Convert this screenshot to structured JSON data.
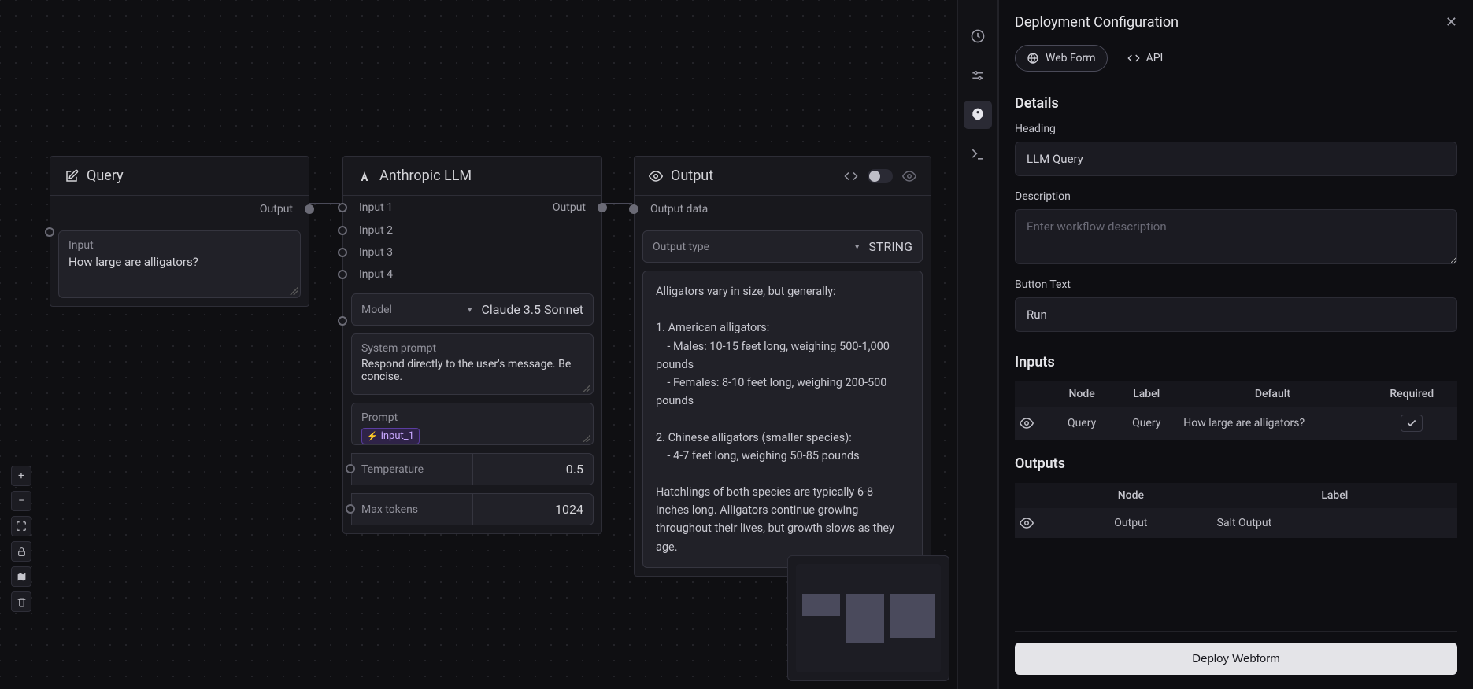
{
  "nodes": {
    "query": {
      "title": "Query",
      "port_output": "Output",
      "input_label": "Input",
      "input_value": "How large are alligators?"
    },
    "llm": {
      "title": "Anthropic LLM",
      "port_output": "Output",
      "inputs": [
        "Input 1",
        "Input 2",
        "Input 3",
        "Input 4"
      ],
      "model_label": "Model",
      "model_value": "Claude 3.5 Sonnet",
      "system_prompt_label": "System prompt",
      "system_prompt_value": "Respond directly to the user's message. Be concise.",
      "prompt_label": "Prompt",
      "prompt_chip": "input_1",
      "temperature_label": "Temperature",
      "temperature_value": "0.5",
      "max_tokens_label": "Max tokens",
      "max_tokens_value": "1024"
    },
    "output": {
      "title": "Output",
      "port_input": "Output data",
      "type_label": "Output type",
      "type_value": "STRING",
      "text": "Alligators vary in size, but generally:\n\n1. American alligators:\n    - Males: 10-15 feet long, weighing 500-1,000 pounds\n    - Females: 8-10 feet long, weighing 200-500 pounds\n\n2. Chinese alligators (smaller species):\n    - 4-7 feet long, weighing 50-85 pounds\n\nHatchlings of both species are typically 6-8 inches long. Alligators continue growing throughout their lives, but growth slows as they age."
    }
  },
  "panel": {
    "title": "Deployment Configuration",
    "tabs": {
      "web_form": "Web Form",
      "api": "API"
    },
    "details": {
      "section": "Details",
      "heading_label": "Heading",
      "heading_value": "LLM Query",
      "description_label": "Description",
      "description_placeholder": "Enter workflow description",
      "button_label": "Button Text",
      "button_value": "Run"
    },
    "inputs": {
      "section": "Inputs",
      "cols": {
        "node": "Node",
        "label": "Label",
        "default": "Default",
        "required": "Required"
      },
      "row": {
        "node": "Query",
        "label": "Query",
        "default": "How large are alligators?",
        "required": true
      }
    },
    "outputs": {
      "section": "Outputs",
      "cols": {
        "node": "Node",
        "label": "Label"
      },
      "row": {
        "node": "Output",
        "label": "Salt Output"
      }
    },
    "deploy_button": "Deploy Webform"
  }
}
